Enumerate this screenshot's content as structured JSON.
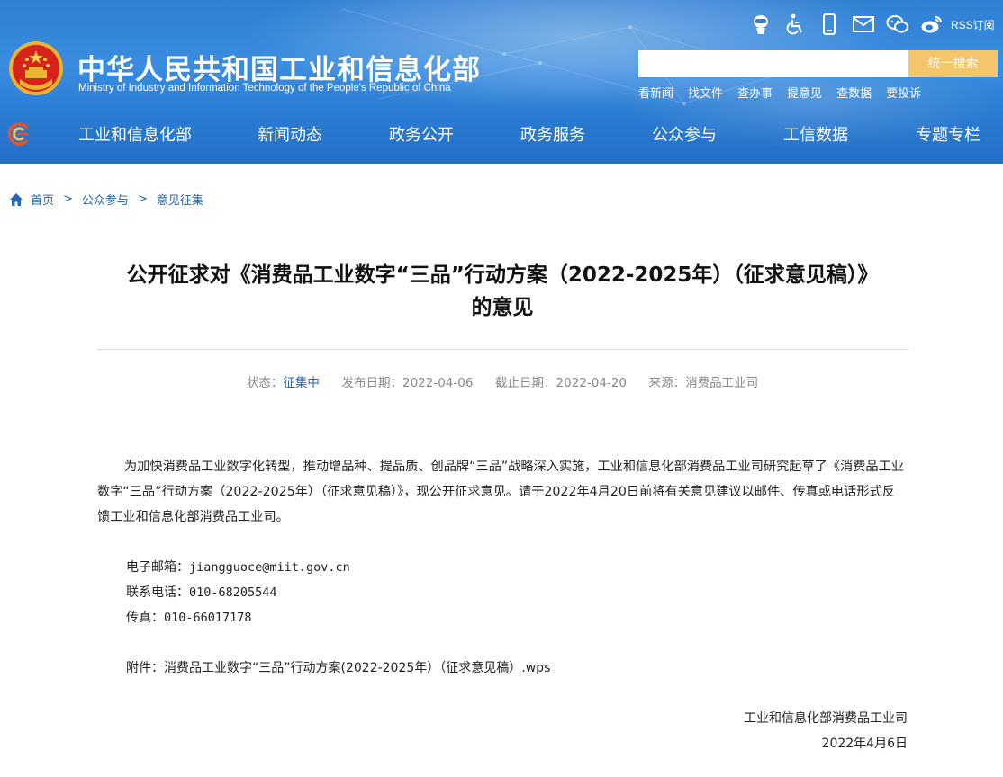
{
  "header": {
    "site_title": "中华人民共和国工业和信息化部",
    "site_subtitle": "Ministry of Industry and Information Technology of the People's Republic of China",
    "rss_label": "RSS订阅",
    "util_icons": [
      "robot-icon",
      "accessibility-icon",
      "mobile-icon",
      "mail-icon",
      "wechat-icon",
      "weibo-icon"
    ],
    "search": {
      "placeholder": "",
      "button_label": "统一搜索",
      "button_color": "#f5c669"
    },
    "quick_links": [
      "看新闻",
      "找文件",
      "查办事",
      "提意见",
      "查数据",
      "要投诉"
    ]
  },
  "nav": {
    "items": [
      "工业和信息化部",
      "新闻动态",
      "政务公开",
      "政务服务",
      "公众参与",
      "工信数据",
      "专题专栏"
    ]
  },
  "breadcrumb": {
    "items": [
      "首页",
      "公众参与",
      "意见征集"
    ],
    "separator": ">"
  },
  "article": {
    "title_line1": "公开征求对《消费品工业数字“三品”行动方案（2022-2025年）（征求意见稿）》",
    "title_line2": "的意见",
    "meta": {
      "status_label": "状态：",
      "status_value": "征集中",
      "publish_label": "发布日期：",
      "publish_date": "2022-04-06",
      "deadline_label": "截止日期：",
      "deadline_date": "2022-04-20",
      "source_label": "来源：",
      "source_value": "消费品工业司"
    },
    "body": "为加快消费品工业数字化转型，推动增品种、提品质、创品牌“三品”战略深入实施，工业和信息化部消费品工业司研究起草了《消费品工业数字“三品”行动方案（2022-2025年）（征求意见稿）》，现公开征求意见。请于2022年4月20日前将有关意见建议以邮件、传真或电话形式反馈工业和信息化部消费品工业司。",
    "email_label": "电子邮箱：",
    "email_value": "jiangguoce@miit.gov.cn",
    "phone_label": "联系电话：",
    "phone_value": "010-68205544",
    "fax_label": "传真：",
    "fax_value": "010-66017178",
    "attachment_label": "附件：",
    "attachment_name": "消费品工业数字“三品”行动方案(2022-2025年）（征求意见稿）.wps",
    "signature_org": "工业和信息化部消费品工业司",
    "signature_date": "2022年4月6日"
  },
  "colors": {
    "header_blue": "#2e80d6",
    "link_blue": "#2466b4",
    "accent_orange": "#f5c669"
  }
}
